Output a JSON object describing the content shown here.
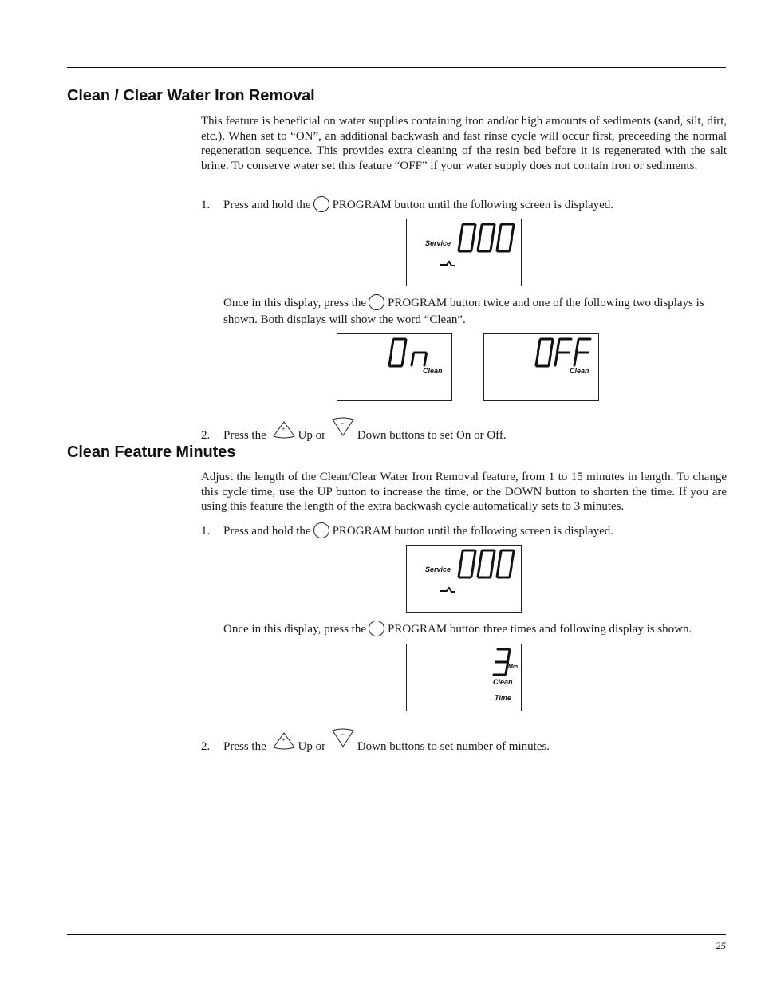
{
  "section1": {
    "title": "Clean / Clear Water Iron Removal",
    "intro": "This feature is beneficial on water supplies containing iron and/or high amounts of sediments (sand, silt, dirt, etc.). When set to “ON”, an additional backwash and fast rinse cycle will occur first, preceeding the normal regeneration sequence. This provides extra cleaning of the resin bed before it is regenerated with the salt brine.  To conserve water set this feature “OFF” if your water supply does not contain iron or sediments.",
    "step1": {
      "num": "1.",
      "before": "Press and hold the",
      "after": "PROGRAM button until  the following screen is displayed."
    },
    "display_service": {
      "label": "Service",
      "digits": "000"
    },
    "sub1": {
      "before": "Once in this display, press the",
      "after": "PROGRAM button twice and one of the following two displays is shown. Both displays will show the word “Clean”."
    },
    "display_on": {
      "value": "On",
      "label": "Clean"
    },
    "display_off": {
      "value": "OFF",
      "label": "Clean"
    },
    "step2": {
      "num": "2.",
      "before": "Press the",
      "up": "Up or",
      "after": "Down buttons to set On or Off."
    }
  },
  "section2": {
    "title": "Clean Feature Minutes",
    "intro": "Adjust the length of the Clean/Clear Water Iron Removal feature, from 1 to 15 minutes in length. To change this cycle time, use the UP button to increase the time, or the DOWN button to shorten the time. If you are using this feature the length of the extra backwash cycle automatically sets to 3 minutes.",
    "step1": {
      "num": "1.",
      "before": "Press and hold the",
      "after": "PROGRAM button until  the following screen is displayed."
    },
    "display_service": {
      "label": "Service",
      "digits": "000"
    },
    "sub1": {
      "before": "Once in this display, press the",
      "after": "PROGRAM button three times and following display is shown."
    },
    "display_minutes": {
      "value": "3",
      "unit": "Min.",
      "label1": "Clean",
      "label2": "Time"
    },
    "step2": {
      "num": "2.",
      "before": "Press the",
      "up": "Up or",
      "after": "Down buttons to set number of minutes."
    }
  },
  "footer": {
    "page_number": "25"
  }
}
